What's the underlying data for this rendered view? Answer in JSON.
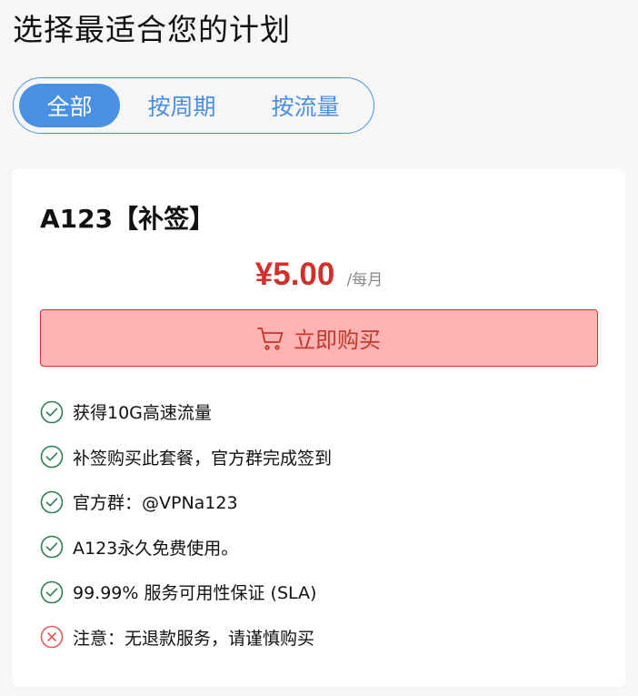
{
  "page": {
    "title": "选择最适合您的计划"
  },
  "tabs": [
    {
      "label": "全部",
      "active": true
    },
    {
      "label": "按周期",
      "active": false
    },
    {
      "label": "按流量",
      "active": false
    }
  ],
  "plan": {
    "name": "A123【补签】",
    "price": "¥5.00",
    "period": "/每月",
    "buy_label": "立即购买",
    "features": [
      {
        "text": "获得10G高速流量",
        "icon": "check-circle-icon",
        "status": "included"
      },
      {
        "text": "补签购买此套餐，官方群完成签到",
        "icon": "check-circle-icon",
        "status": "included"
      },
      {
        "text": "官方群：@VPNa123",
        "icon": "check-circle-icon",
        "status": "included"
      },
      {
        "text": "A123永久免费使用。",
        "icon": "check-circle-icon",
        "status": "included"
      },
      {
        "text": "99.99% 服务可用性保证 (SLA)",
        "icon": "check-circle-icon",
        "status": "included"
      },
      {
        "text": "注意：无退款服务，请谨慎购买",
        "icon": "x-circle-icon",
        "status": "excluded"
      }
    ]
  },
  "colors": {
    "accent": "#4a90e2",
    "price": "#d0312d",
    "buy_bg": "#ffb3b3",
    "check": "#2e7d4f",
    "cross": "#e05a5a"
  }
}
